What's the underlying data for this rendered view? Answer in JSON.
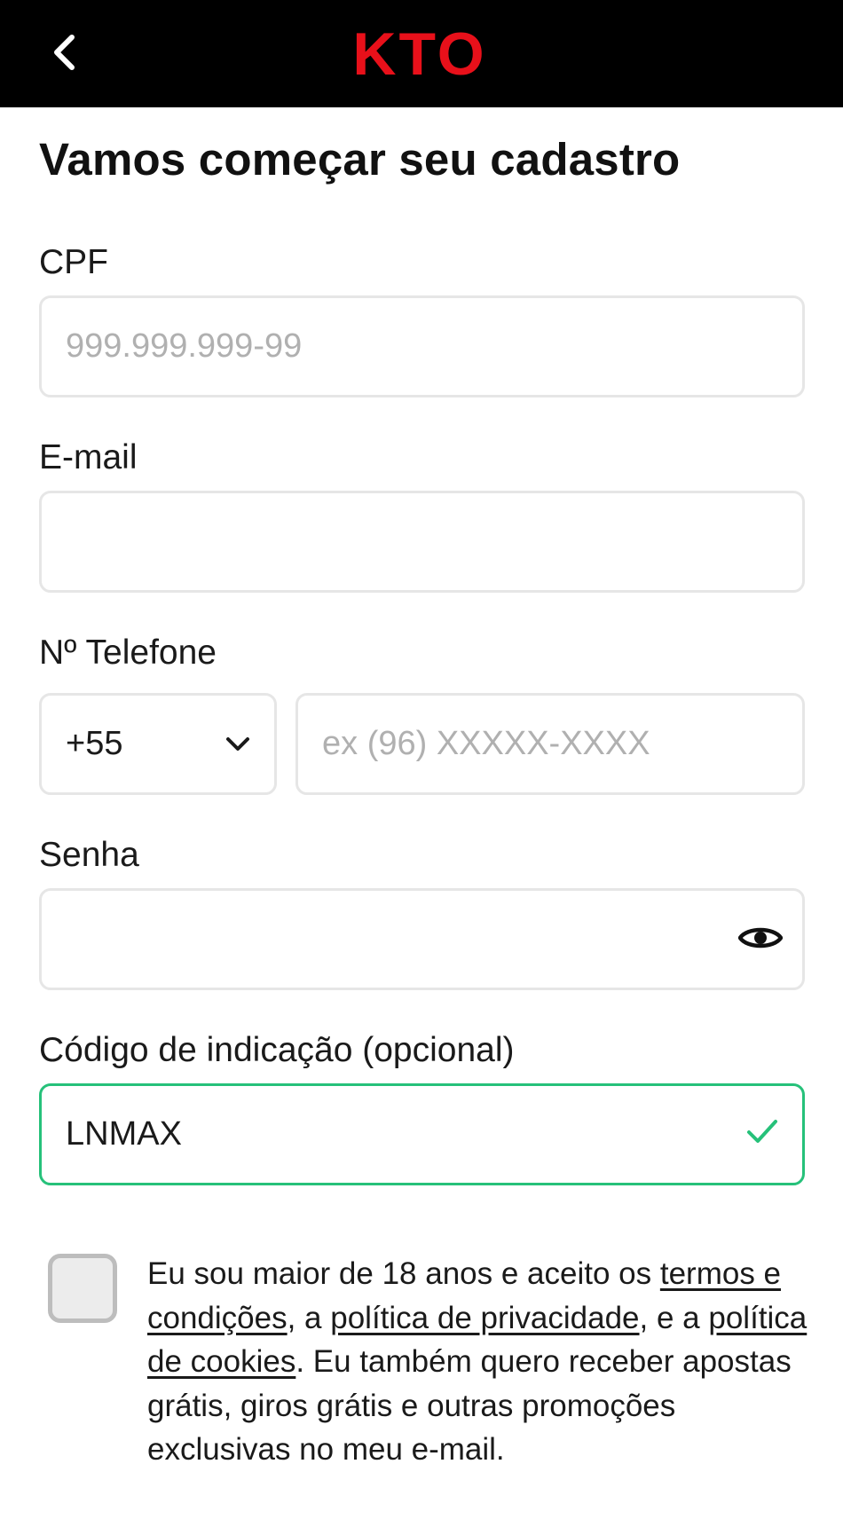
{
  "header": {
    "back_icon": "chevron-left-icon",
    "logo_text": "KTO",
    "logo_color": "#e8101a"
  },
  "page_title": "Vamos começar seu cadastro",
  "form": {
    "cpf": {
      "label": "CPF",
      "placeholder": "999.999.999-99",
      "value": ""
    },
    "email": {
      "label": "E-mail",
      "placeholder": "",
      "value": ""
    },
    "phone": {
      "label": "Nº Telefone",
      "country_code": "+55",
      "country_icon": "chevron-down-icon",
      "placeholder": "ex (96) XXXXX-XXXX",
      "value": ""
    },
    "password": {
      "label": "Senha",
      "value": "",
      "toggle_icon": "eye-icon"
    },
    "referral": {
      "label": "Código de indicação (opcional)",
      "value": "LNMAX",
      "status_icon": "check-icon",
      "valid_color": "#26c17a"
    }
  },
  "consent": {
    "checked": false,
    "text_1": "Eu sou maior de 18 anos e aceito os ",
    "link_terms": "termos e condições",
    "text_2": ", a ",
    "link_privacy": "política de privacidade",
    "text_3": ", e a ",
    "link_cookies": "política de cookies",
    "text_4": ". Eu também quero receber apostas grátis, giros grátis e outras promoções exclusivas no meu e-mail."
  }
}
